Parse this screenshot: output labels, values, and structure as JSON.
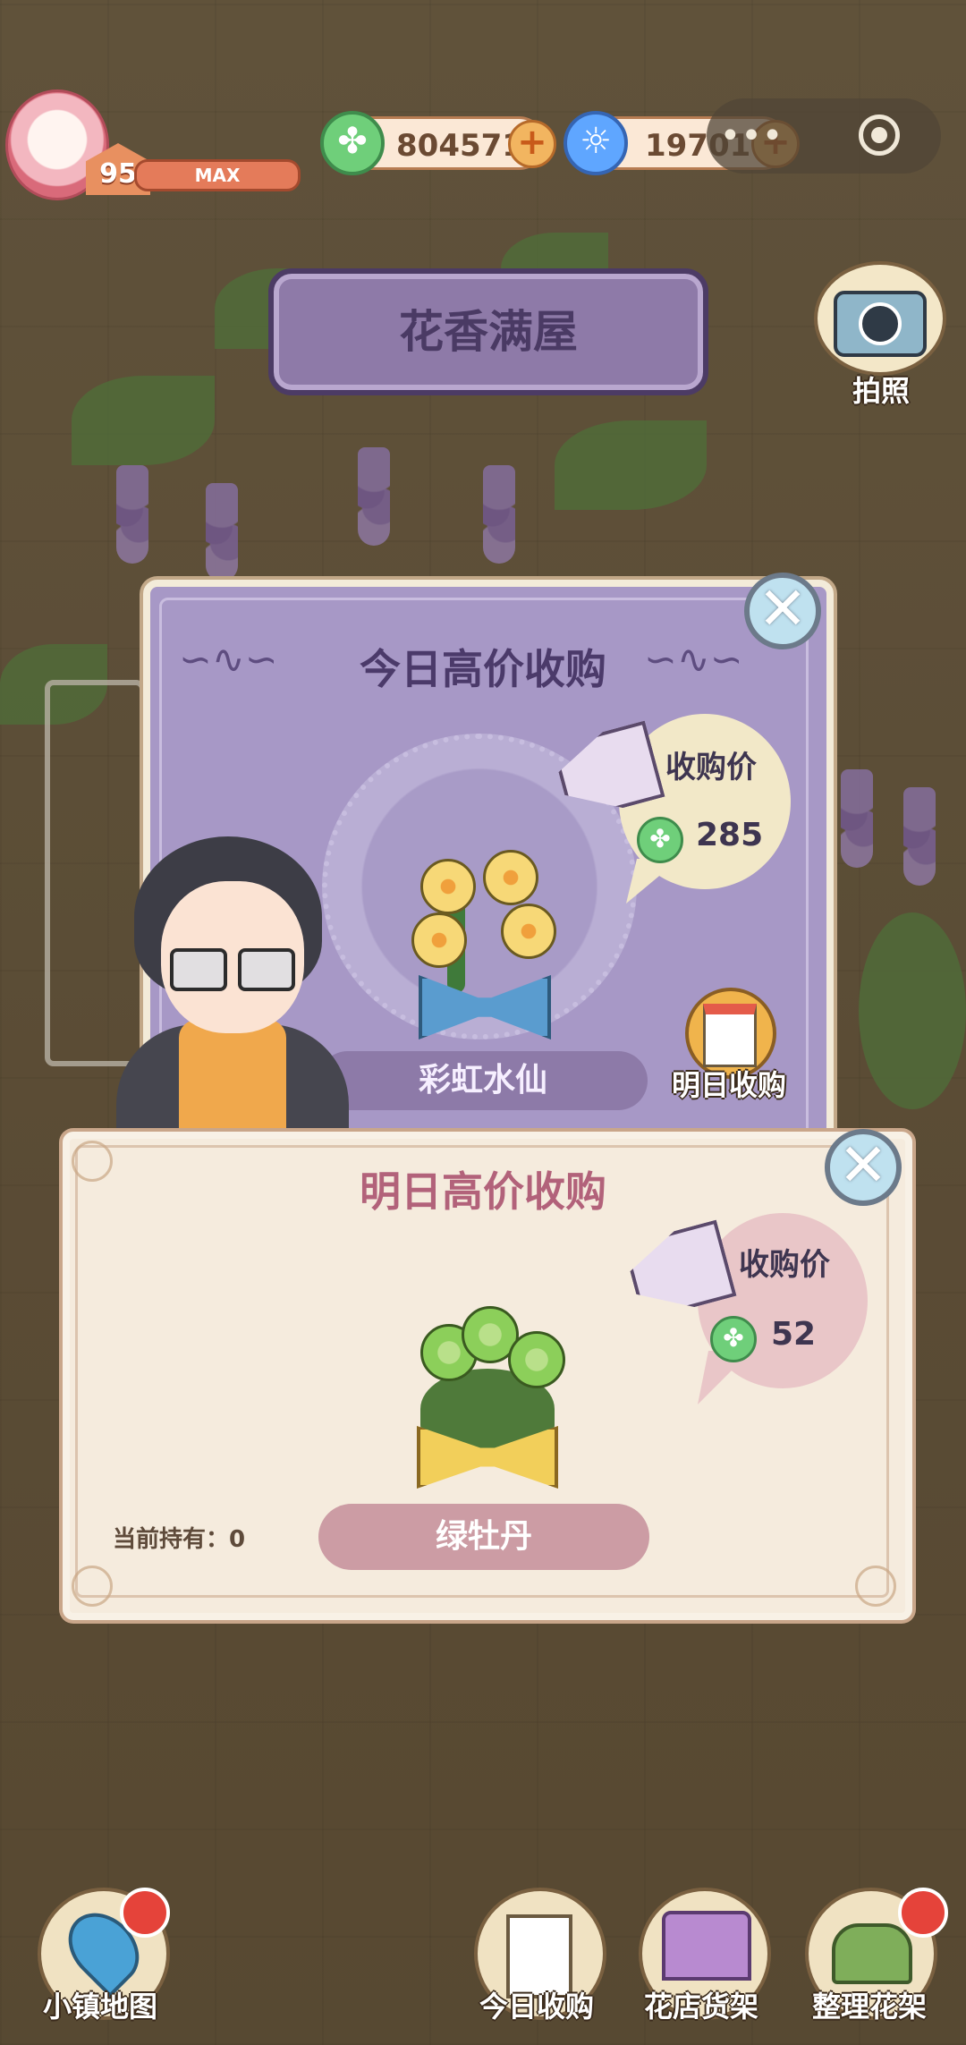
{
  "player": {
    "level": "95",
    "level_status": "MAX"
  },
  "currency": {
    "coins": "804571",
    "gems": "19701"
  },
  "title_banner": "花香满屋",
  "camera": {
    "label": "拍照"
  },
  "today_panel": {
    "title": "今日高价收购",
    "price_label": "收购价",
    "price": "285",
    "flower_name": "彩虹水仙",
    "tomorrow_button": "明日收购"
  },
  "tomorrow_panel": {
    "title": "明日高价收购",
    "price_label": "收购价",
    "price": "52",
    "holding": "当前持有：0",
    "flower_name": "绿牡丹"
  },
  "bottom_nav": {
    "town_map": "小镇地图",
    "today_purchase": "今日收购",
    "shop_shelf": "花店货架",
    "arrange_shelf": "整理花架"
  },
  "colors": {
    "today_panel_bg": "#a798c6",
    "tomorrow_panel_bg": "#f5ebdd",
    "coin_green": "#6fcf7a",
    "gem_blue": "#5fa6ff"
  }
}
